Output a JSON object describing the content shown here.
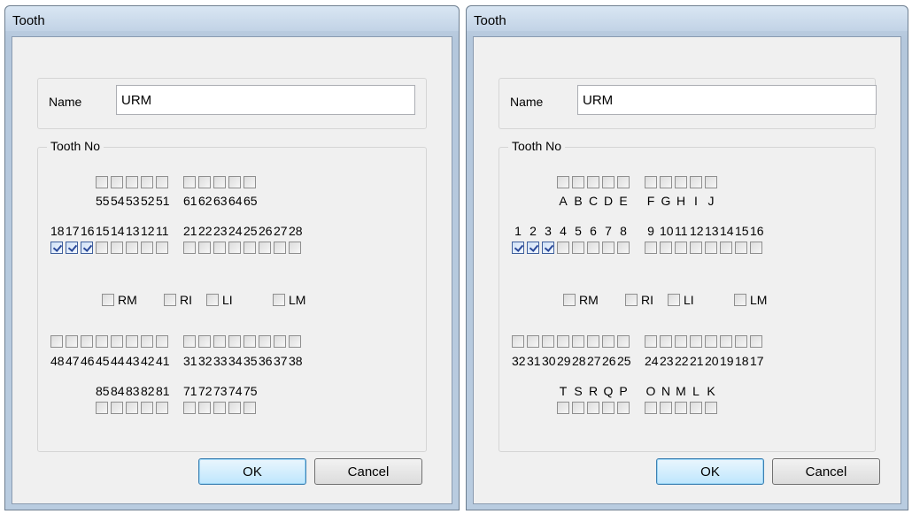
{
  "dialogs": [
    {
      "title": "Tooth",
      "name_label": "Name",
      "name_value": "URM",
      "group_label": "Tooth No",
      "primary_upper_labels": [
        "55",
        "54",
        "53",
        "52",
        "51",
        "61",
        "62",
        "63",
        "64",
        "65"
      ],
      "permanent_upper_labels": [
        "18",
        "17",
        "16",
        "15",
        "14",
        "13",
        "12",
        "11",
        "21",
        "22",
        "23",
        "24",
        "25",
        "26",
        "27",
        "28"
      ],
      "permanent_upper_checked": [
        true,
        true,
        true,
        false,
        false,
        false,
        false,
        false,
        false,
        false,
        false,
        false,
        false,
        false,
        false,
        false
      ],
      "quadrants": [
        "RM",
        "RI",
        "LI",
        "LM"
      ],
      "permanent_lower_labels": [
        "48",
        "47",
        "46",
        "45",
        "44",
        "43",
        "42",
        "41",
        "31",
        "32",
        "33",
        "34",
        "35",
        "36",
        "37",
        "38"
      ],
      "primary_lower_labels": [
        "85",
        "84",
        "83",
        "82",
        "81",
        "71",
        "72",
        "73",
        "74",
        "75"
      ],
      "ok_label": "OK",
      "cancel_label": "Cancel"
    },
    {
      "title": "Tooth",
      "name_label": "Name",
      "name_value": "URM",
      "group_label": "Tooth No",
      "primary_upper_labels": [
        "A",
        "B",
        "C",
        "D",
        "E",
        "F",
        "G",
        "H",
        "I",
        "J"
      ],
      "permanent_upper_labels": [
        "1",
        "2",
        "3",
        "4",
        "5",
        "6",
        "7",
        "8",
        "9",
        "10",
        "11",
        "12",
        "13",
        "14",
        "15",
        "16"
      ],
      "permanent_upper_checked": [
        true,
        true,
        true,
        false,
        false,
        false,
        false,
        false,
        false,
        false,
        false,
        false,
        false,
        false,
        false,
        false
      ],
      "quadrants": [
        "RM",
        "RI",
        "LI",
        "LM"
      ],
      "permanent_lower_labels": [
        "32",
        "31",
        "30",
        "29",
        "28",
        "27",
        "26",
        "25",
        "24",
        "23",
        "22",
        "21",
        "20",
        "19",
        "18",
        "17"
      ],
      "primary_lower_labels": [
        "T",
        "S",
        "R",
        "Q",
        "P",
        "O",
        "N",
        "M",
        "L",
        "K"
      ],
      "ok_label": "OK",
      "cancel_label": "Cancel"
    }
  ]
}
